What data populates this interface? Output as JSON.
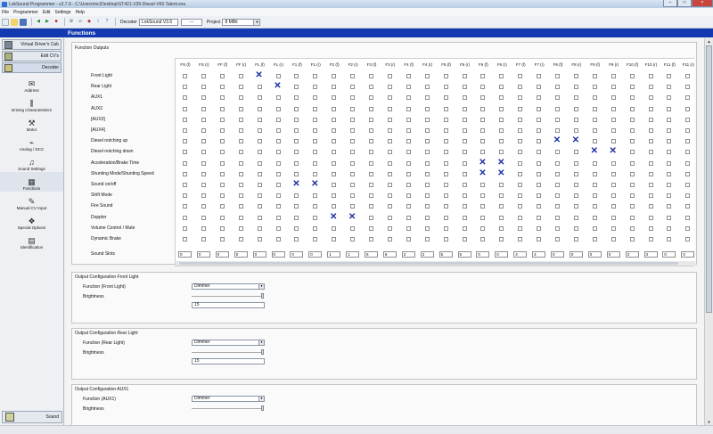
{
  "window": {
    "title": "LokSound Programmer - v2.7.9 - C:\\Users\\mc\\Desktop\\ST421-V35-Diesel-V60 Talent.esu"
  },
  "menu": [
    "File",
    "Programmer",
    "Edit",
    "Settings",
    "Help"
  ],
  "toolbar": {
    "decoder_label": "Decoder",
    "decoder_value": "LokSound V3.5",
    "field2": "---",
    "project_label": "Project",
    "project_value": "8 MBit"
  },
  "page_title": "Functions",
  "sidebar": {
    "top_items": [
      "Virtual Driver's Cab",
      "Edit CV's",
      "Decoder"
    ],
    "items": [
      {
        "label": "Address",
        "icon": "envelope-icon"
      },
      {
        "label": "Driving Characteristics",
        "icon": "sliders-icon"
      },
      {
        "label": "Motor",
        "icon": "motor-icon"
      },
      {
        "label": "Analog / DCC",
        "icon": "analog-icon"
      },
      {
        "label": "Sound Settings",
        "icon": "music-icon"
      },
      {
        "label": "Functions",
        "icon": "functions-icon"
      },
      {
        "label": "Manual CV Input",
        "icon": "wrench-icon"
      },
      {
        "label": "Special Options",
        "icon": "options-icon"
      },
      {
        "label": "Identification",
        "icon": "id-icon"
      }
    ],
    "bottom_item": "Sound"
  },
  "function_outputs": {
    "title": "Function Outputs",
    "columns": [
      "FS (f)",
      "FS (r)",
      "FF (f)",
      "FF (r)",
      "FL (f)",
      "FL (r)",
      "F1 (f)",
      "F1 (r)",
      "F2 (f)",
      "F2 (r)",
      "F3 (f)",
      "F3 (r)",
      "F4 (f)",
      "F4 (r)",
      "F5 (f)",
      "F5 (r)",
      "F6 (f)",
      "F6 (r)",
      "F7 (f)",
      "F7 (r)",
      "F8 (f)",
      "F8 (r)",
      "F9 (f)",
      "F9 (r)",
      "F10 (f)",
      "F10 (r)",
      "F11 (f)",
      "F11 (r)"
    ],
    "rows": [
      "Front Light",
      "Rear Light",
      "AUX1",
      "AUX2",
      "[AUX3]",
      "[AUX4]",
      "Diesel notching up",
      "Diesel notching down",
      "Acceleration/Brake Time",
      "Shunting Mode/Shunting Speed",
      "Sound on/off",
      "Shift Mode",
      "Fire Sound",
      "Doppler",
      "Volume Control / Mute",
      "Dynamic Brake"
    ],
    "checked": [
      [
        0,
        4
      ],
      [
        1,
        5
      ],
      [
        6,
        20
      ],
      [
        6,
        21
      ],
      [
        7,
        22
      ],
      [
        7,
        23
      ],
      [
        8,
        16
      ],
      [
        8,
        17
      ],
      [
        9,
        16
      ],
      [
        9,
        17
      ],
      [
        10,
        6
      ],
      [
        10,
        7
      ],
      [
        13,
        8
      ],
      [
        13,
        9
      ]
    ],
    "sound_slots_label": "Sound Slots",
    "sound_slots": [
      "0",
      "0",
      "0",
      "0",
      "0",
      "0",
      "0",
      "0",
      "1",
      "1",
      "6",
      "6",
      "2",
      "2",
      "5",
      "5",
      "0",
      "0",
      "4",
      "4",
      "0",
      "0",
      "0",
      "0",
      "3",
      "3",
      "0",
      "0"
    ]
  },
  "output_config": [
    {
      "title": "Output Configuration Front Light",
      "function_label": "Function (Front Light)",
      "function_value": "Dimmer",
      "brightness_label": "Brightness",
      "brightness_value": "15"
    },
    {
      "title": "Output Configuration Rear Light",
      "function_label": "Function (Rear Light)",
      "function_value": "Dimmer",
      "brightness_label": "Brightness",
      "brightness_value": "15"
    },
    {
      "title": "Output Configuration AUX1",
      "function_label": "Function (AUX1)",
      "function_value": "Dimmer",
      "brightness_label": "Brightness",
      "brightness_value": ""
    }
  ]
}
